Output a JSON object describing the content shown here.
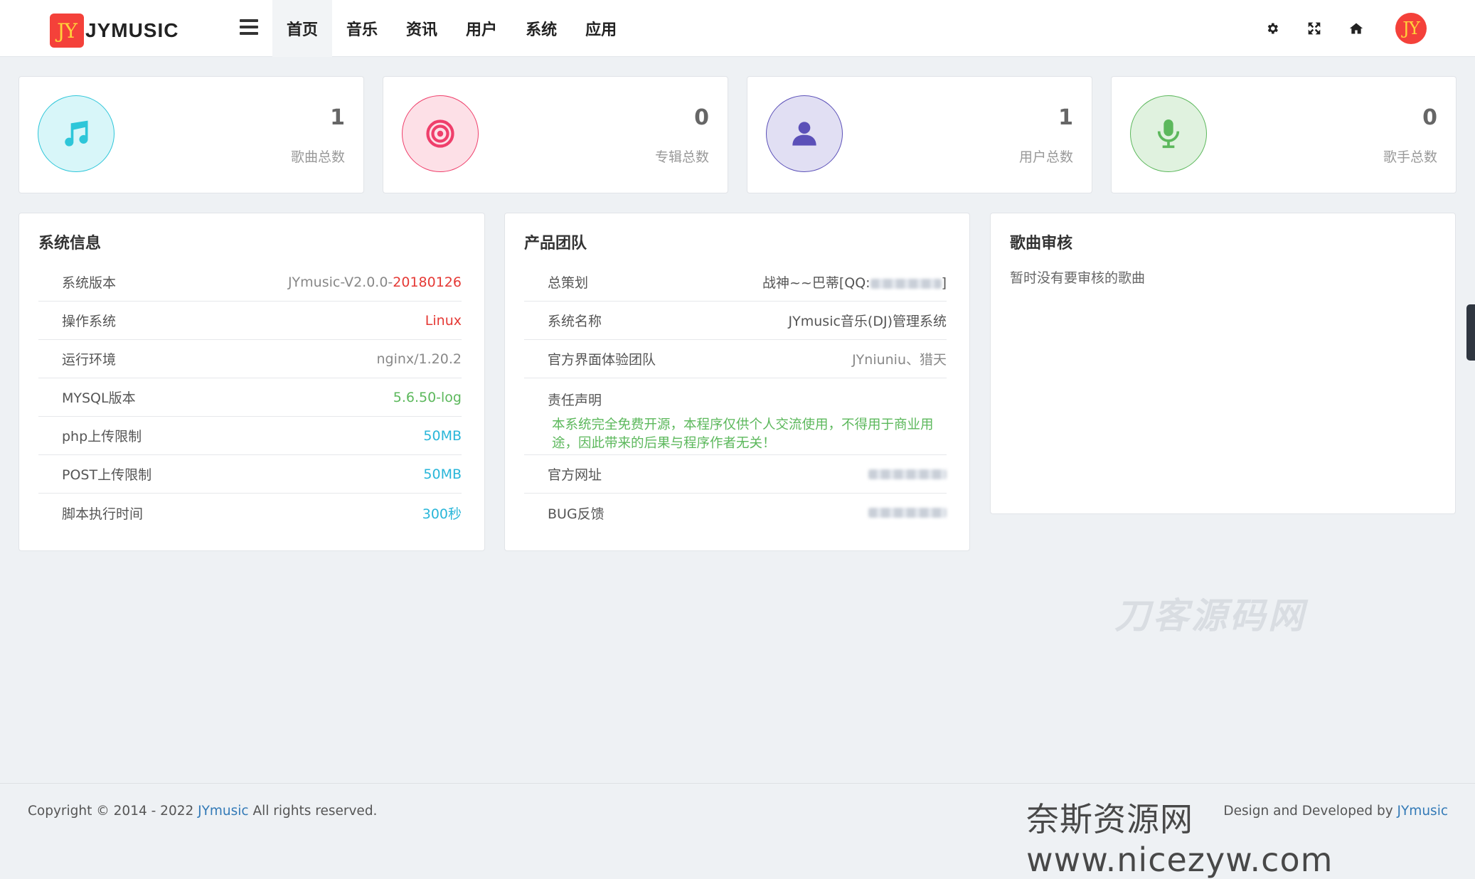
{
  "brand": {
    "badge": "JY",
    "name": "JYMUSIC"
  },
  "nav": {
    "items": [
      {
        "label": "首页",
        "active": true
      },
      {
        "label": "音乐",
        "active": false
      },
      {
        "label": "资讯",
        "active": false
      },
      {
        "label": "用户",
        "active": false
      },
      {
        "label": "系统",
        "active": false
      },
      {
        "label": "应用",
        "active": false
      }
    ]
  },
  "toolbar": {
    "icons": [
      "gear-icon",
      "fullscreen-icon",
      "home-icon"
    ],
    "avatar": "JY"
  },
  "stats": [
    {
      "value": "1",
      "label": "歌曲总数",
      "icon": "music-note-icon",
      "color": "#2ec6d9",
      "bg": "#d8f6f9"
    },
    {
      "value": "0",
      "label": "专辑总数",
      "icon": "target-icon",
      "color": "#ef3f6b",
      "bg": "#fde0e7"
    },
    {
      "value": "1",
      "label": "用户总数",
      "icon": "user-icon",
      "color": "#5b50b8",
      "bg": "#e1dff3"
    },
    {
      "value": "0",
      "label": "歌手总数",
      "icon": "microphone-icon",
      "color": "#5cb85c",
      "bg": "#e0f2df"
    }
  ],
  "system_info": {
    "title": "系统信息",
    "version_label": "系统版本",
    "version_prefix": "JYmusic-V2.0.0-",
    "version_date": "20180126",
    "os_label": "操作系统",
    "os_value": "Linux",
    "env_label": "运行环境",
    "env_value": "nginx/1.20.2",
    "mysql_label": "MYSQL版本",
    "mysql_value": "5.6.50-log",
    "php_label": "php上传限制",
    "php_value": "50MB",
    "post_label": "POST上传限制",
    "post_value": "50MB",
    "exec_label": "脚本执行时间",
    "exec_value": "300秒"
  },
  "team": {
    "title": "产品团队",
    "planner_label": "总策划",
    "planner_value_prefix": "战神~~巴蒂[QQ:",
    "planner_value_suffix": "]",
    "name_label": "系统名称",
    "name_value": "JYmusic音乐(DJ)管理系统",
    "ui_label": "官方界面体验团队",
    "ui_value": "JYniuniu、猎天",
    "disclaimer_label": "责任声明",
    "disclaimer_text": "本系统完全免费开源，本程序仅供个人交流使用，不得用于商业用途，因此带来的后果与程序作者无关！",
    "site_label": "官方网址",
    "bug_label": "BUG反馈"
  },
  "review": {
    "title": "歌曲审核",
    "empty_text": "暂时没有要审核的歌曲"
  },
  "watermark": {
    "center": "刀客源码网",
    "footer": "奈斯资源网www.nicezyw.com"
  },
  "footer": {
    "copyright_prefix": "Copyright © 2014 - 2022 ",
    "copyright_link": "JYmusic",
    "copyright_suffix": " All rights reserved.",
    "credit_prefix": "Design and Developed by ",
    "credit_link": "JYmusic"
  }
}
